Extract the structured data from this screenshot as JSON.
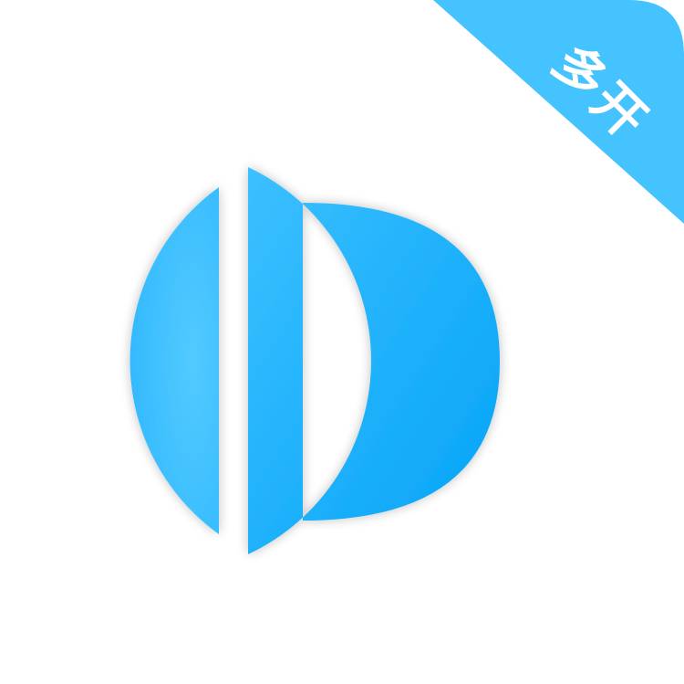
{
  "badge": {
    "label": "多开",
    "color": "#45C3FE",
    "text_color": "#FFFFFF"
  },
  "logo": {
    "icon": "d-letter-circle-logo-icon",
    "colors": {
      "light_blue": "#4FC8FF",
      "mid_blue": "#2EB6FF",
      "deep_blue": "#05A4F8",
      "background": "#FFFFFF"
    }
  }
}
